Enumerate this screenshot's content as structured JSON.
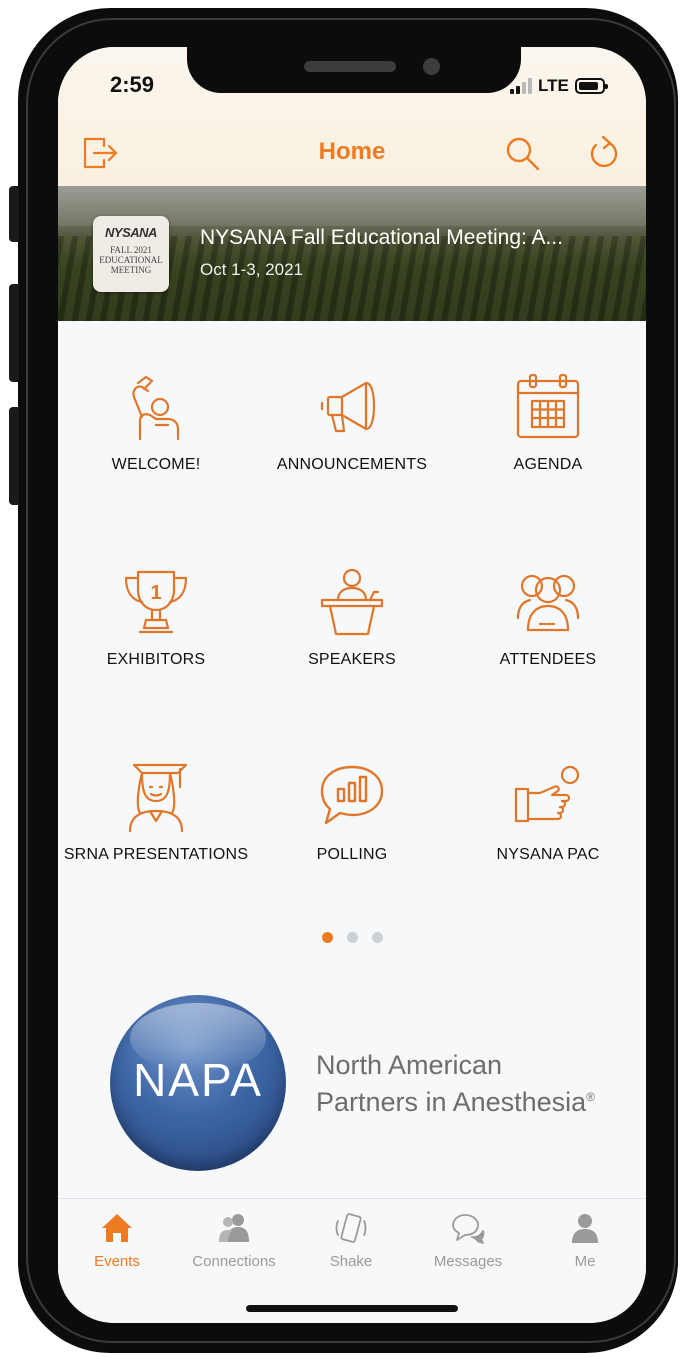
{
  "status": {
    "time": "2:59",
    "network": "LTE"
  },
  "nav": {
    "title": "Home",
    "icons": [
      "logout-icon",
      "search-icon",
      "refresh-icon"
    ]
  },
  "event": {
    "logo_brand": "NYSANA",
    "logo_line1": "FALL 2021",
    "logo_line2": "EDUCATIONAL",
    "logo_line3": "MEETING",
    "title": "NYSANA Fall Educational Meeting: A...",
    "dates": "Oct 1-3, 2021"
  },
  "grid": [
    {
      "label": "WELCOME!",
      "icon": "welcome-wave-icon"
    },
    {
      "label": "ANNOUNCEMENTS",
      "icon": "megaphone-icon"
    },
    {
      "label": "AGENDA",
      "icon": "calendar-icon"
    },
    {
      "label": "EXHIBITORS",
      "icon": "trophy-icon",
      "trophy_number": "1"
    },
    {
      "label": "SPEAKERS",
      "icon": "podium-speaker-icon"
    },
    {
      "label": "ATTENDEES",
      "icon": "people-group-icon"
    },
    {
      "label": "SRNA PRESENTATIONS",
      "icon": "graduate-icon"
    },
    {
      "label": "POLLING",
      "icon": "poll-bubble-icon"
    },
    {
      "label": "NYSANA PAC",
      "icon": "pointing-hand-icon"
    }
  ],
  "pager": {
    "count": 3,
    "active": 1
  },
  "sponsor": {
    "logo_text": "NAPA",
    "name_line1": "North American",
    "name_line2": "Partners in Anesthesia",
    "mark": "®"
  },
  "tabs": [
    {
      "label": "Events",
      "icon": "home-icon",
      "active": true
    },
    {
      "label": "Connections",
      "icon": "people-icon",
      "active": false
    },
    {
      "label": "Shake",
      "icon": "phone-shake-icon",
      "active": false
    },
    {
      "label": "Messages",
      "icon": "chat-bubbles-icon",
      "active": false
    },
    {
      "label": "Me",
      "icon": "person-icon",
      "active": false
    }
  ],
  "colors": {
    "accent": "#ee7b22",
    "tab_inactive": "#9a9a9a",
    "napa_blue": "#3d66a6"
  }
}
